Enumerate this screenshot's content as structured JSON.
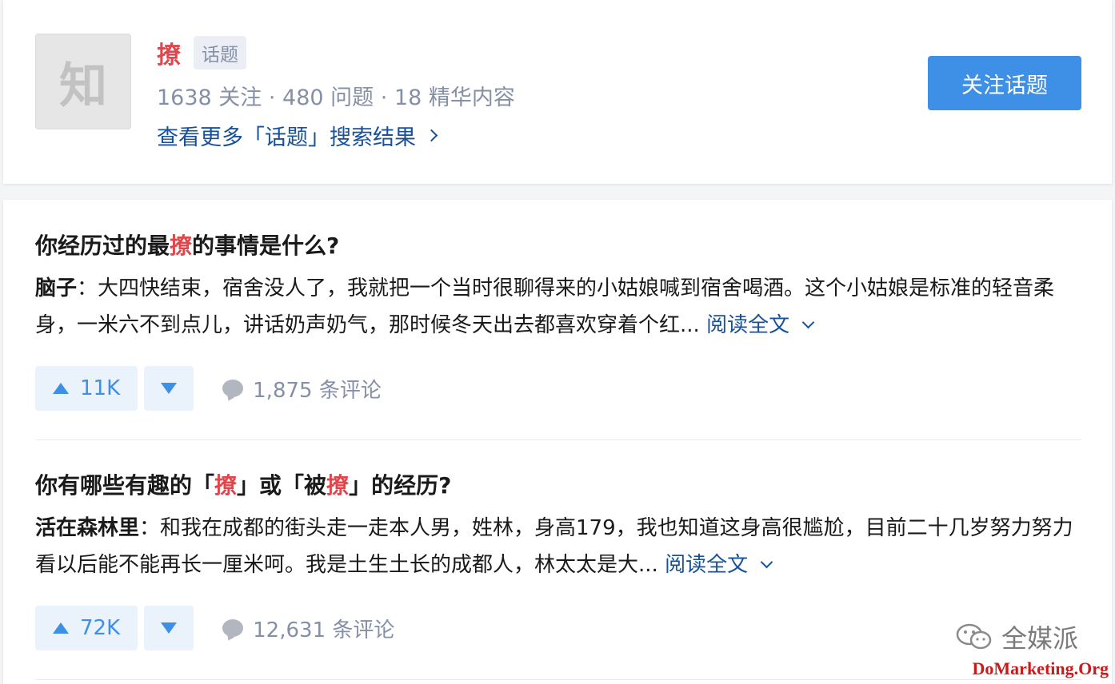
{
  "topic": {
    "avatar_char": "知",
    "name": "撩",
    "tag": "话题",
    "stats": "1638 关注 · 480 问题 · 18 精华内容",
    "more_link": "查看更多「话题」搜索结果",
    "follow_button": "关注话题"
  },
  "results": [
    {
      "title_parts": [
        "你经历过的最",
        "撩",
        "的事情是什么?"
      ],
      "author": "脑子",
      "excerpt": "：大四快结束，宿舍没人了，我就把一个当时很聊得来的小姑娘喊到宿舍喝酒。这个小姑娘是标准的轻音柔身，一米六不到点儿，讲话奶声奶气，那时候冬天出去都喜欢穿着个红...",
      "read_more": "阅读全文",
      "upvotes": "11K",
      "comments": "1,875 条评论"
    },
    {
      "title_parts": [
        "你有哪些有趣的「",
        "撩",
        "」或「被",
        "撩",
        "」的经历?"
      ],
      "author": "活在森林里",
      "excerpt": "：和我在成都的街头走一走本人男，姓林，身高179，我也知道这身高很尴尬，目前二十几岁努力努力看以后能不能再长一厘米呵。我是土生土长的成都人，林太太是大...",
      "read_more": "阅读全文",
      "upvotes": "72K",
      "comments": "12,631 条评论"
    }
  ],
  "watermark": {
    "brand": "全媒派",
    "url": "DoMarketing.Org"
  },
  "colors": {
    "highlight": "#e0464b",
    "link": "#175199",
    "primary": "#3e8fe6",
    "muted": "#8590a6"
  }
}
